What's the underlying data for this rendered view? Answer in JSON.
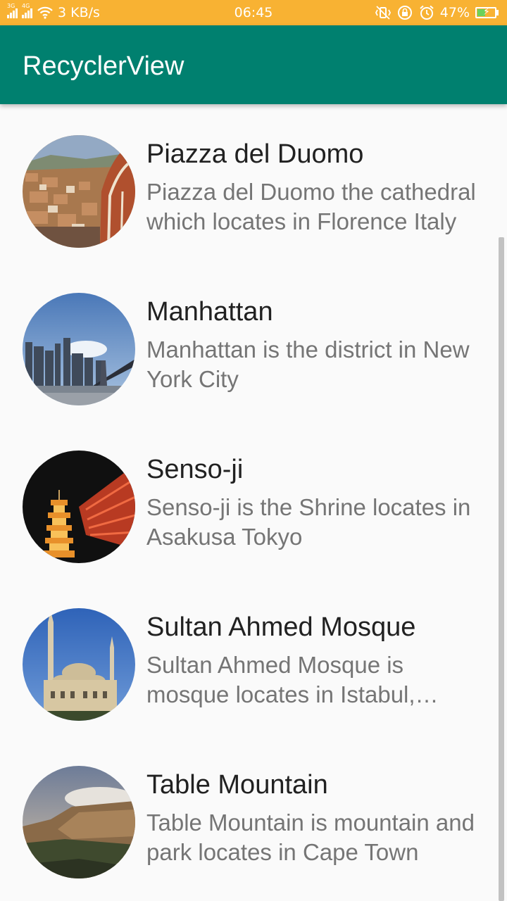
{
  "status_bar": {
    "net_speed": "3 KB/s",
    "time": "06:45",
    "battery_percent": "47%",
    "battery_level": 0.47,
    "signal_labels": [
      "3G",
      "4G"
    ],
    "icons": [
      "signal-icon",
      "wifi-icon",
      "vibrate-icon",
      "rotation-lock-icon",
      "alarm-icon",
      "battery-charging-icon"
    ],
    "color": "#f8b233"
  },
  "app_bar": {
    "title": "RecyclerView",
    "color": "#00806f"
  },
  "list": {
    "items": [
      {
        "title": "Piazza del Duomo",
        "description": "Piazza del Duomo the cathedral which locates in Florence Italy",
        "image": "piazza-del-duomo-photo"
      },
      {
        "title": "Manhattan",
        "description": "Manhattan is the district in New York City",
        "image": "manhattan-photo"
      },
      {
        "title": "Senso-ji",
        "description": "Senso-ji is the Shrine locates in Asakusa Tokyo",
        "image": "senso-ji-photo"
      },
      {
        "title": "Sultan Ahmed Mosque",
        "description": "Sultan Ahmed Mosque is mosque locates in Istabul, Turkey",
        "image": "sultan-ahmed-mosque-photo"
      },
      {
        "title": "Table Mountain",
        "description": "Table Mountain is mountain and park locates in Cape Town",
        "image": "table-mountain-photo"
      }
    ]
  }
}
